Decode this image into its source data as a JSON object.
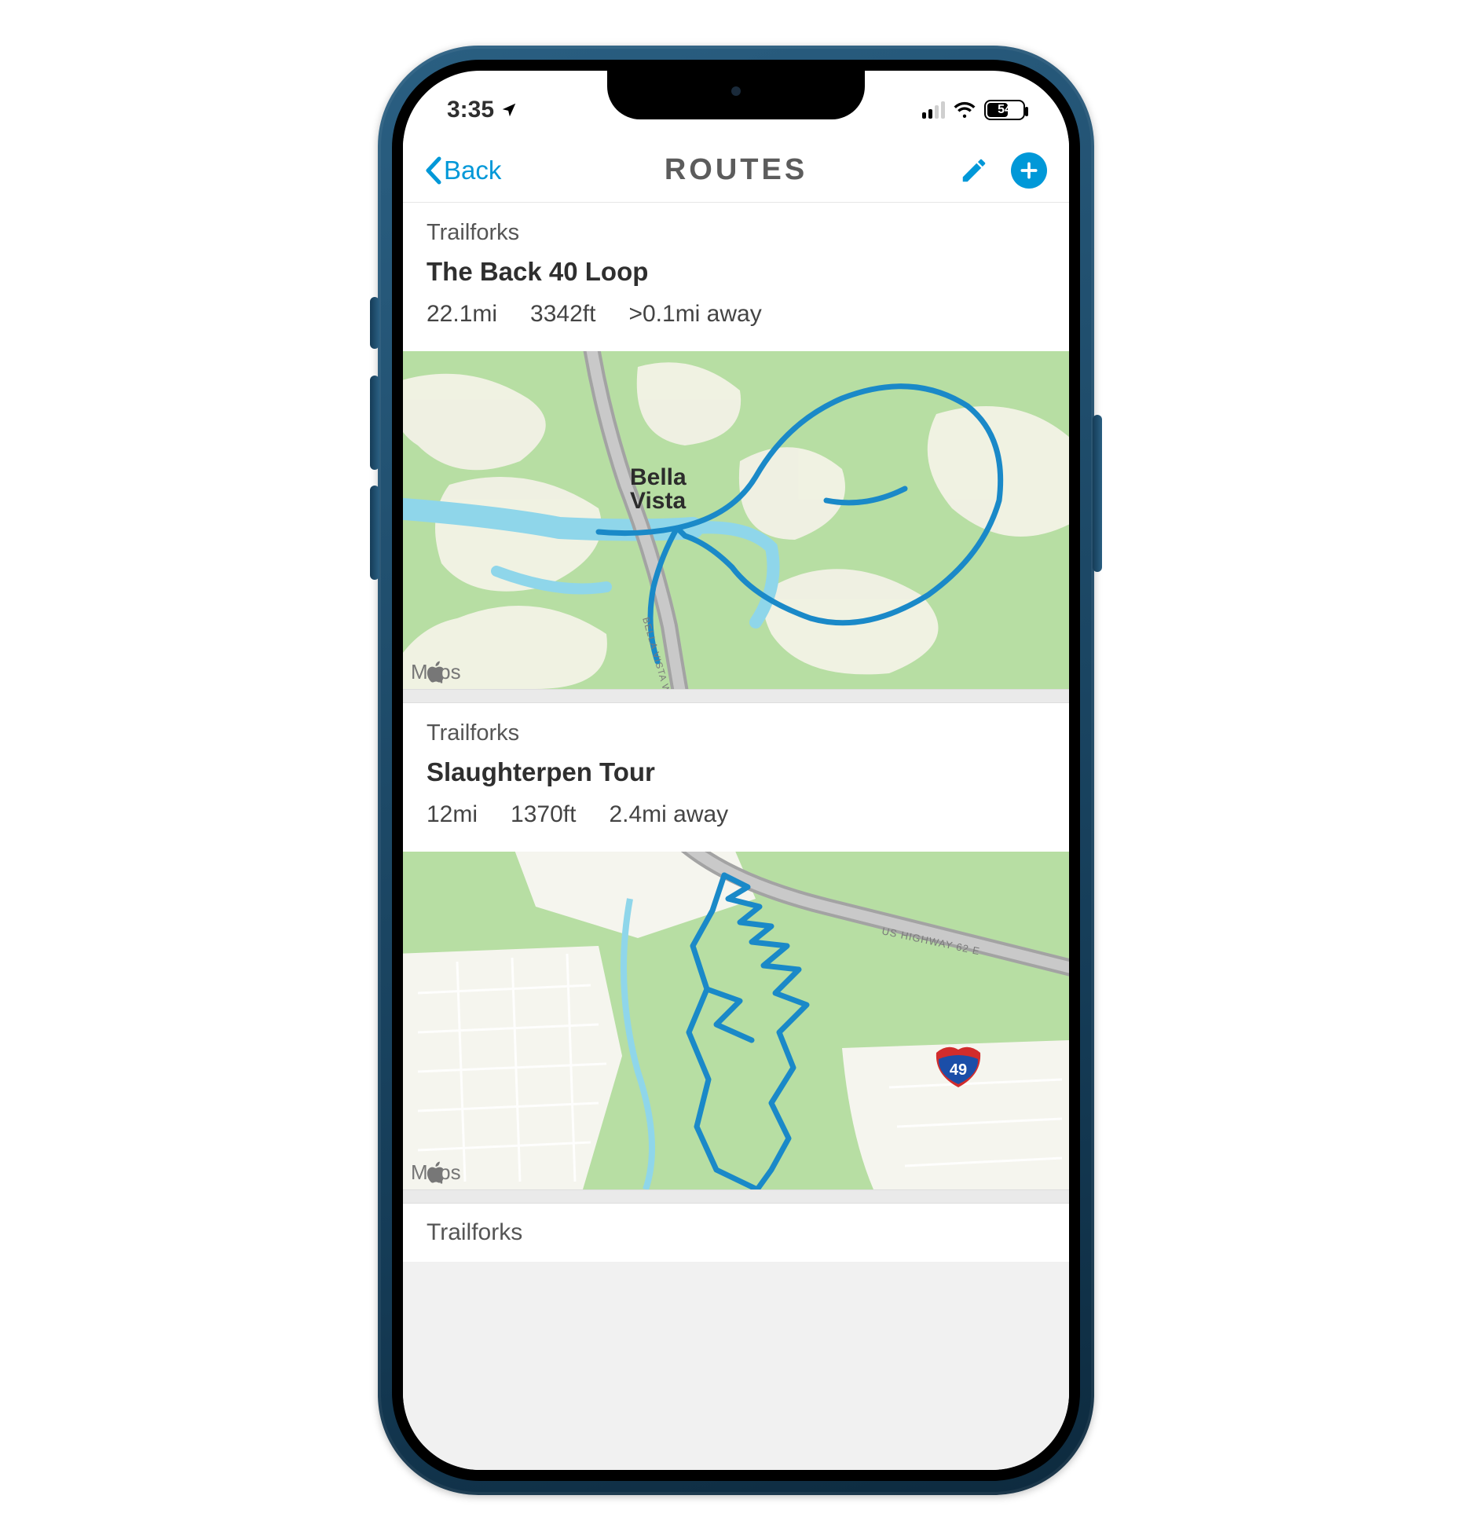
{
  "status": {
    "time": "3:35",
    "battery": "54"
  },
  "nav": {
    "back_label": "Back",
    "title": "ROUTES"
  },
  "maps_attr": "Maps",
  "routes": [
    {
      "source": "Trailforks",
      "name": "The Back 40 Loop",
      "distance": "22.1mi",
      "elevation": "3342ft",
      "away": ">0.1mi away",
      "place_label": "Bella Vista",
      "road_label": "BELLA VISTA WAY"
    },
    {
      "source": "Trailforks",
      "name": "Slaughterpen Tour",
      "distance": "12mi",
      "elevation": "1370ft",
      "away": "2.4mi away",
      "highway_label": "US HIGHWAY 62 E",
      "interstate": "49"
    },
    {
      "source": "Trailforks"
    }
  ]
}
